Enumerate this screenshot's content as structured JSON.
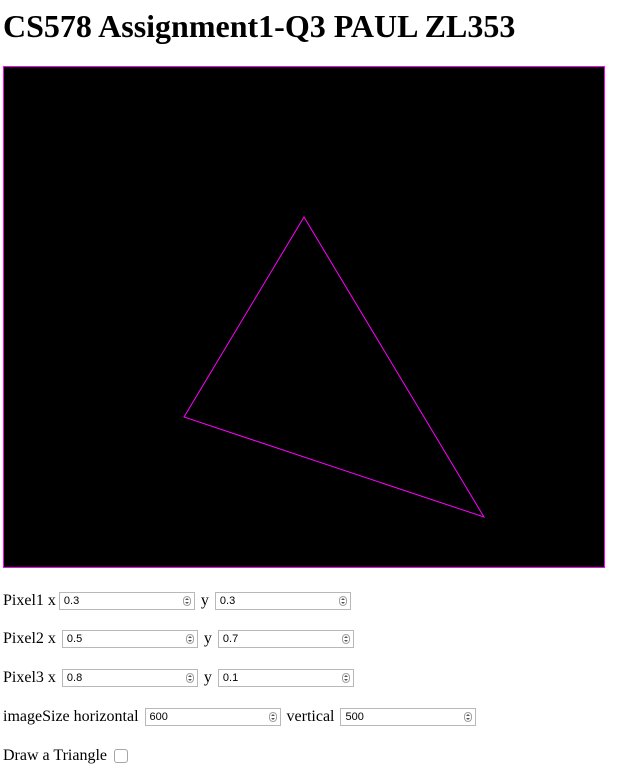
{
  "header": {
    "title": "CS578 Assignment1-Q3 PAUL ZL353"
  },
  "canvas": {
    "background": "#000000",
    "stroke_color": "#ff00ff"
  },
  "pixels": [
    {
      "label": "Pixel1 x",
      "x_value": "0.3",
      "y_label": "y",
      "y_value": "0.3"
    },
    {
      "label": "Pixel2 x",
      "x_value": "0.5",
      "y_label": "y",
      "y_value": "0.7"
    },
    {
      "label": "Pixel3 x",
      "x_value": "0.8",
      "y_label": "y",
      "y_value": "0.1"
    }
  ],
  "image_size": {
    "horizontal_label": "imageSize horizontal",
    "horizontal_value": "600",
    "vertical_label": "vertical",
    "vertical_value": "500"
  },
  "draw": {
    "label": "Draw a Triangle",
    "checked": false
  }
}
